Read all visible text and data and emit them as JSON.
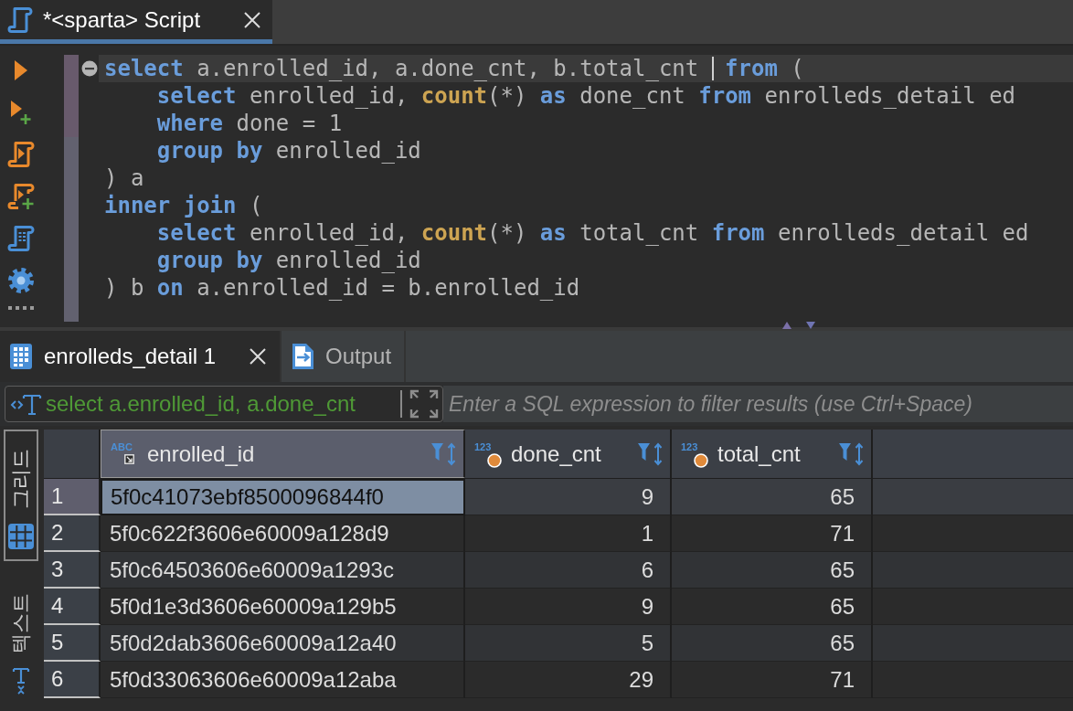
{
  "editor_tab": {
    "title": "*<sparta> Script",
    "selected": true
  },
  "editor": {
    "lines": [
      {
        "current": true,
        "fold": true,
        "modified": true,
        "tokens": [
          {
            "kind": "keyword",
            "text": "select"
          },
          {
            "kind": "plain",
            "text": " a.enrolled_id, a.done_cnt, b.total_cnt "
          },
          {
            "kind": "cursor"
          },
          {
            "kind": "keyword",
            "text": " from"
          },
          {
            "kind": "plain",
            "text": " ("
          }
        ]
      },
      {
        "current": false,
        "fold": false,
        "modified": true,
        "tokens": [
          {
            "kind": "keyword",
            "text": "    select"
          },
          {
            "kind": "plain",
            "text": " enrolled_id, "
          },
          {
            "kind": "function",
            "text": "count"
          },
          {
            "kind": "plain",
            "text": "(*) "
          },
          {
            "kind": "keyword",
            "text": "as"
          },
          {
            "kind": "plain",
            "text": " done_cnt "
          },
          {
            "kind": "keyword",
            "text": "from"
          },
          {
            "kind": "plain",
            "text": " enrolleds_detail ed"
          }
        ]
      },
      {
        "current": false,
        "fold": false,
        "modified": true,
        "tokens": [
          {
            "kind": "keyword",
            "text": "    where"
          },
          {
            "kind": "plain",
            "text": " done = 1"
          }
        ]
      },
      {
        "current": false,
        "fold": false,
        "modified": false,
        "tokens": [
          {
            "kind": "keyword",
            "text": "    group by"
          },
          {
            "kind": "plain",
            "text": " enrolled_id"
          }
        ]
      },
      {
        "current": false,
        "fold": false,
        "modified": false,
        "tokens": [
          {
            "kind": "plain",
            "text": ") a"
          }
        ]
      },
      {
        "current": false,
        "fold": false,
        "modified": false,
        "tokens": [
          {
            "kind": "keyword",
            "text": "inner join"
          },
          {
            "kind": "plain",
            "text": " ("
          }
        ]
      },
      {
        "current": false,
        "fold": false,
        "modified": false,
        "tokens": [
          {
            "kind": "keyword",
            "text": "    select"
          },
          {
            "kind": "plain",
            "text": " enrolled_id, "
          },
          {
            "kind": "function",
            "text": "count"
          },
          {
            "kind": "plain",
            "text": "(*) "
          },
          {
            "kind": "keyword",
            "text": "as"
          },
          {
            "kind": "plain",
            "text": " total_cnt "
          },
          {
            "kind": "keyword",
            "text": "from"
          },
          {
            "kind": "plain",
            "text": " enrolleds_detail ed"
          }
        ]
      },
      {
        "current": false,
        "fold": false,
        "modified": false,
        "tokens": [
          {
            "kind": "keyword",
            "text": "    group by"
          },
          {
            "kind": "plain",
            "text": " enrolled_id"
          }
        ]
      },
      {
        "current": false,
        "fold": false,
        "modified": false,
        "tokens": [
          {
            "kind": "plain",
            "text": ") b "
          },
          {
            "kind": "keyword",
            "text": "on"
          },
          {
            "kind": "plain",
            "text": " a.enrolled_id = b.enrolled_id"
          }
        ]
      }
    ]
  },
  "result_tabs": [
    {
      "kind": "table",
      "label": "enrolleds_detail 1",
      "selected": true,
      "closable": true
    },
    {
      "kind": "output",
      "label": "Output",
      "selected": false,
      "closable": false
    }
  ],
  "filter": {
    "query": "select a.enrolled_id, a.done_cnt",
    "placeholder": "Enter a SQL expression to filter results (use Ctrl+Space)"
  },
  "view_tabs": [
    {
      "kind": "grid",
      "label": "그리드",
      "selected": true
    },
    {
      "kind": "text",
      "label": "텍스트",
      "selected": false
    }
  ],
  "table": {
    "columns": [
      {
        "kind": "text",
        "type_label": "ABC",
        "name": "enrolled_id",
        "selected": true
      },
      {
        "kind": "number",
        "type_label": "123",
        "name": "done_cnt",
        "selected": false
      },
      {
        "kind": "number",
        "type_label": "123",
        "name": "total_cnt",
        "selected": false
      }
    ],
    "rows": [
      {
        "number": "1",
        "selected": true,
        "cells": [
          {
            "value": "5f0c41073ebf8500096844f0",
            "selected": true
          },
          {
            "value": "9",
            "selected": false
          },
          {
            "value": "65",
            "selected": false
          }
        ]
      },
      {
        "number": "2",
        "selected": false,
        "cells": [
          {
            "value": "5f0c622f3606e60009a128d9",
            "selected": false
          },
          {
            "value": "1",
            "selected": false
          },
          {
            "value": "71",
            "selected": false
          }
        ]
      },
      {
        "number": "3",
        "selected": false,
        "cells": [
          {
            "value": "5f0c64503606e60009a1293c",
            "selected": false
          },
          {
            "value": "6",
            "selected": false
          },
          {
            "value": "65",
            "selected": false
          }
        ]
      },
      {
        "number": "4",
        "selected": false,
        "cells": [
          {
            "value": "5f0d1e3d3606e60009a129b5",
            "selected": false
          },
          {
            "value": "9",
            "selected": false
          },
          {
            "value": "65",
            "selected": false
          }
        ]
      },
      {
        "number": "5",
        "selected": false,
        "cells": [
          {
            "value": "5f0d2dab3606e60009a12a40",
            "selected": false
          },
          {
            "value": "5",
            "selected": false
          },
          {
            "value": "65",
            "selected": false
          }
        ]
      },
      {
        "number": "6",
        "selected": false,
        "cells": [
          {
            "value": "5f0d33063606e60009a12aba",
            "selected": false
          },
          {
            "value": "29",
            "selected": false
          },
          {
            "value": "71",
            "selected": false
          }
        ]
      }
    ]
  }
}
